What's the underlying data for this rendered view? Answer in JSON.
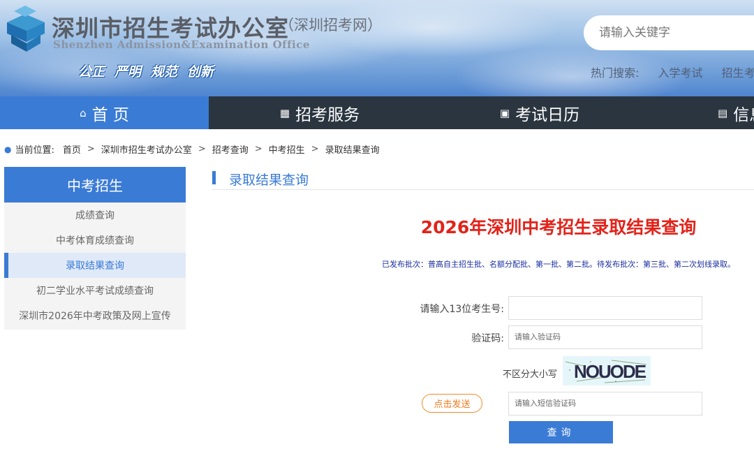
{
  "header": {
    "title": "深圳市招生考试办公室",
    "subtitle": "（深圳招考网）",
    "title_en": "Shenzhen Admission&Examination Office",
    "slogan": [
      "公正",
      "严明",
      "规范",
      "创新"
    ],
    "search_placeholder": "请输入关键字",
    "hot_label": "热门搜索:",
    "hot_links": [
      "入学考试",
      "招生考"
    ]
  },
  "nav": {
    "items": [
      {
        "label": "首 页",
        "icon": "home-icon",
        "glyph": "⌂"
      },
      {
        "label": "招考服务",
        "icon": "grid-icon",
        "glyph": "▦"
      },
      {
        "label": "考试日历",
        "icon": "calendar-icon",
        "glyph": "▣"
      },
      {
        "label": "信息",
        "icon": "document-icon",
        "glyph": "▤"
      }
    ],
    "active_index": 0
  },
  "breadcrumb": {
    "prefix": "当前位置:",
    "items": [
      "首页",
      "深圳市招生考试办公室",
      "招考查询",
      "中考招生",
      "录取结果查询"
    ],
    "separator": ">"
  },
  "sidebar": {
    "title": "中考招生",
    "items": [
      {
        "label": "成绩查询"
      },
      {
        "label": "中考体育成绩查询"
      },
      {
        "label": "录取结果查询"
      },
      {
        "label": "初二学业水平考试成绩查询"
      },
      {
        "label": "深圳市2026年中考政策及网上宣传"
      }
    ],
    "active_index": 2
  },
  "main": {
    "section_title": "录取结果查询",
    "page_title": "2026年深圳中考招生录取结果查询",
    "notice": "已发布批次：普高自主招生批、名额分配批、第一批、第二批。待发布批次：第三批、第二次划线录取。",
    "form": {
      "exam_no_label": "请输入13位考生号:",
      "exam_no_value": "",
      "captcha_label": "验证码:",
      "captcha_placeholder": "请输入验证码",
      "captcha_hint": "不区分大小写",
      "captcha_text": "NOUODE",
      "sms_button": "点击发送",
      "sms_placeholder": "请输入短信验证码",
      "submit": "查询"
    }
  },
  "colors": {
    "primary": "#3a7bd5",
    "nav_bg": "#2b3540",
    "title_red": "#e2231a",
    "notice_blue": "#1a2ea0",
    "sms_orange": "#f07a1a"
  }
}
